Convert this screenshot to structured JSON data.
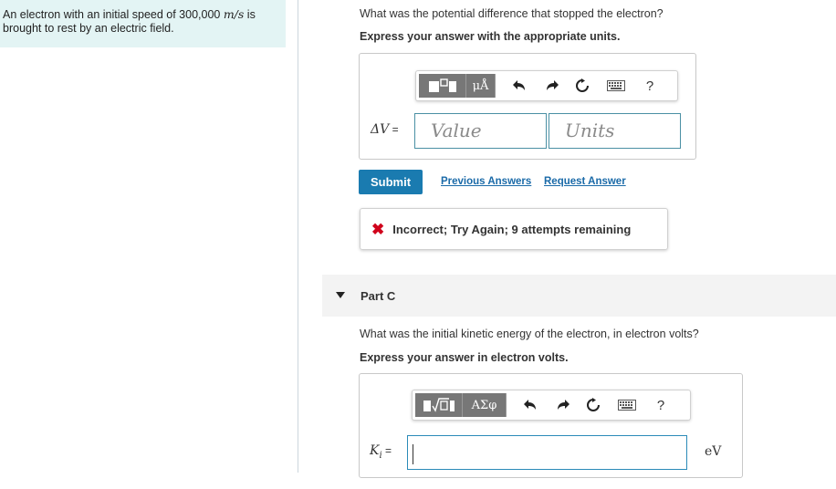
{
  "problem": {
    "text_before": "An electron with an initial speed of 300,000 ",
    "speed_unit": "m/s",
    "text_after": " is brought to rest by an electric field."
  },
  "part_b": {
    "question": "What was the potential difference that stopped the electron?",
    "instruction": "Express your answer with the appropriate units.",
    "toolbar": {
      "template_label": "▯▯",
      "units_label": "μÅ",
      "help_label": "?",
      "icons": [
        "undo-icon",
        "redo-icon",
        "reset-icon",
        "keyboard-icon",
        "help-icon"
      ]
    },
    "label_symbol": "ΔV",
    "label_eq": " =",
    "value_placeholder": "Value",
    "units_placeholder": "Units",
    "submit_label": "Submit",
    "previous_answers_label": "Previous Answers",
    "request_answer_label": "Request Answer",
    "feedback_icon": "✖",
    "feedback_text": "Incorrect; Try Again; 9 attempts remaining"
  },
  "part_c": {
    "title": "Part C",
    "question": "What was the initial kinetic energy of the electron, in electron volts?",
    "instruction": "Express your answer in electron volts.",
    "toolbar": {
      "template_label": "√▯",
      "symbols_label": "ΑΣφ",
      "help_label": "?"
    },
    "label_symbol": "K",
    "label_sub": "i",
    "label_eq": " =",
    "input_value": "",
    "unit": "eV"
  },
  "colors": {
    "accent": "#1a7bb0",
    "link": "#1a6aa8",
    "panel_bg": "#e3f4f4",
    "error": "#d0021b"
  }
}
